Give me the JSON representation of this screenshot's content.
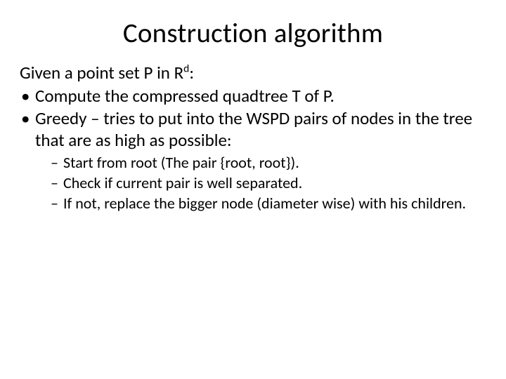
{
  "title": "Construction algorithm",
  "intro_pre": "Given a point set P in R",
  "intro_sup": "d",
  "intro_post": ":",
  "bullets": [
    "Compute the compressed quadtree T of P.",
    "Greedy – tries to put into the WSPD pairs of nodes in the tree that are as high as possible:"
  ],
  "sub_bullets": [
    "Start from root (The pair {root, root}).",
    "Check if current pair is well separated.",
    "If not, replace the bigger node (diameter wise) with his children."
  ]
}
